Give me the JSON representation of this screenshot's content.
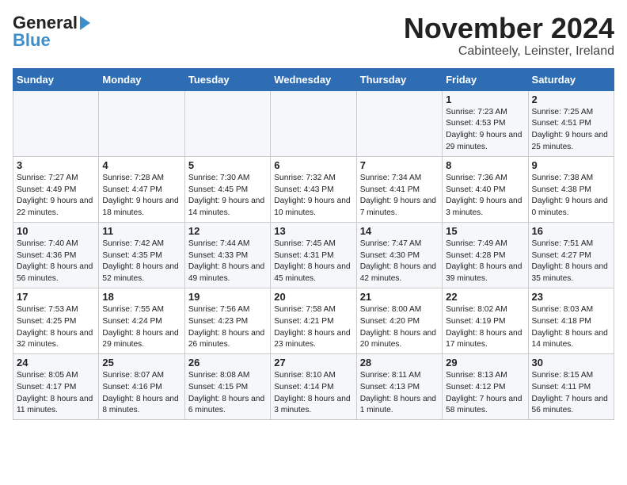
{
  "header": {
    "logo_black": "General",
    "logo_blue": "Blue",
    "month_title": "November 2024",
    "subtitle": "Cabinteely, Leinster, Ireland"
  },
  "days_of_week": [
    "Sunday",
    "Monday",
    "Tuesday",
    "Wednesday",
    "Thursday",
    "Friday",
    "Saturday"
  ],
  "weeks": [
    [
      {
        "day": "",
        "info": ""
      },
      {
        "day": "",
        "info": ""
      },
      {
        "day": "",
        "info": ""
      },
      {
        "day": "",
        "info": ""
      },
      {
        "day": "",
        "info": ""
      },
      {
        "day": "1",
        "info": "Sunrise: 7:23 AM\nSunset: 4:53 PM\nDaylight: 9 hours\nand 29 minutes."
      },
      {
        "day": "2",
        "info": "Sunrise: 7:25 AM\nSunset: 4:51 PM\nDaylight: 9 hours\nand 25 minutes."
      }
    ],
    [
      {
        "day": "3",
        "info": "Sunrise: 7:27 AM\nSunset: 4:49 PM\nDaylight: 9 hours\nand 22 minutes."
      },
      {
        "day": "4",
        "info": "Sunrise: 7:28 AM\nSunset: 4:47 PM\nDaylight: 9 hours\nand 18 minutes."
      },
      {
        "day": "5",
        "info": "Sunrise: 7:30 AM\nSunset: 4:45 PM\nDaylight: 9 hours\nand 14 minutes."
      },
      {
        "day": "6",
        "info": "Sunrise: 7:32 AM\nSunset: 4:43 PM\nDaylight: 9 hours\nand 10 minutes."
      },
      {
        "day": "7",
        "info": "Sunrise: 7:34 AM\nSunset: 4:41 PM\nDaylight: 9 hours\nand 7 minutes."
      },
      {
        "day": "8",
        "info": "Sunrise: 7:36 AM\nSunset: 4:40 PM\nDaylight: 9 hours\nand 3 minutes."
      },
      {
        "day": "9",
        "info": "Sunrise: 7:38 AM\nSunset: 4:38 PM\nDaylight: 9 hours\nand 0 minutes."
      }
    ],
    [
      {
        "day": "10",
        "info": "Sunrise: 7:40 AM\nSunset: 4:36 PM\nDaylight: 8 hours\nand 56 minutes."
      },
      {
        "day": "11",
        "info": "Sunrise: 7:42 AM\nSunset: 4:35 PM\nDaylight: 8 hours\nand 52 minutes."
      },
      {
        "day": "12",
        "info": "Sunrise: 7:44 AM\nSunset: 4:33 PM\nDaylight: 8 hours\nand 49 minutes."
      },
      {
        "day": "13",
        "info": "Sunrise: 7:45 AM\nSunset: 4:31 PM\nDaylight: 8 hours\nand 45 minutes."
      },
      {
        "day": "14",
        "info": "Sunrise: 7:47 AM\nSunset: 4:30 PM\nDaylight: 8 hours\nand 42 minutes."
      },
      {
        "day": "15",
        "info": "Sunrise: 7:49 AM\nSunset: 4:28 PM\nDaylight: 8 hours\nand 39 minutes."
      },
      {
        "day": "16",
        "info": "Sunrise: 7:51 AM\nSunset: 4:27 PM\nDaylight: 8 hours\nand 35 minutes."
      }
    ],
    [
      {
        "day": "17",
        "info": "Sunrise: 7:53 AM\nSunset: 4:25 PM\nDaylight: 8 hours\nand 32 minutes."
      },
      {
        "day": "18",
        "info": "Sunrise: 7:55 AM\nSunset: 4:24 PM\nDaylight: 8 hours\nand 29 minutes."
      },
      {
        "day": "19",
        "info": "Sunrise: 7:56 AM\nSunset: 4:23 PM\nDaylight: 8 hours\nand 26 minutes."
      },
      {
        "day": "20",
        "info": "Sunrise: 7:58 AM\nSunset: 4:21 PM\nDaylight: 8 hours\nand 23 minutes."
      },
      {
        "day": "21",
        "info": "Sunrise: 8:00 AM\nSunset: 4:20 PM\nDaylight: 8 hours\nand 20 minutes."
      },
      {
        "day": "22",
        "info": "Sunrise: 8:02 AM\nSunset: 4:19 PM\nDaylight: 8 hours\nand 17 minutes."
      },
      {
        "day": "23",
        "info": "Sunrise: 8:03 AM\nSunset: 4:18 PM\nDaylight: 8 hours\nand 14 minutes."
      }
    ],
    [
      {
        "day": "24",
        "info": "Sunrise: 8:05 AM\nSunset: 4:17 PM\nDaylight: 8 hours\nand 11 minutes."
      },
      {
        "day": "25",
        "info": "Sunrise: 8:07 AM\nSunset: 4:16 PM\nDaylight: 8 hours\nand 8 minutes."
      },
      {
        "day": "26",
        "info": "Sunrise: 8:08 AM\nSunset: 4:15 PM\nDaylight: 8 hours\nand 6 minutes."
      },
      {
        "day": "27",
        "info": "Sunrise: 8:10 AM\nSunset: 4:14 PM\nDaylight: 8 hours\nand 3 minutes."
      },
      {
        "day": "28",
        "info": "Sunrise: 8:11 AM\nSunset: 4:13 PM\nDaylight: 8 hours\nand 1 minute."
      },
      {
        "day": "29",
        "info": "Sunrise: 8:13 AM\nSunset: 4:12 PM\nDaylight: 7 hours\nand 58 minutes."
      },
      {
        "day": "30",
        "info": "Sunrise: 8:15 AM\nSunset: 4:11 PM\nDaylight: 7 hours\nand 56 minutes."
      }
    ]
  ]
}
